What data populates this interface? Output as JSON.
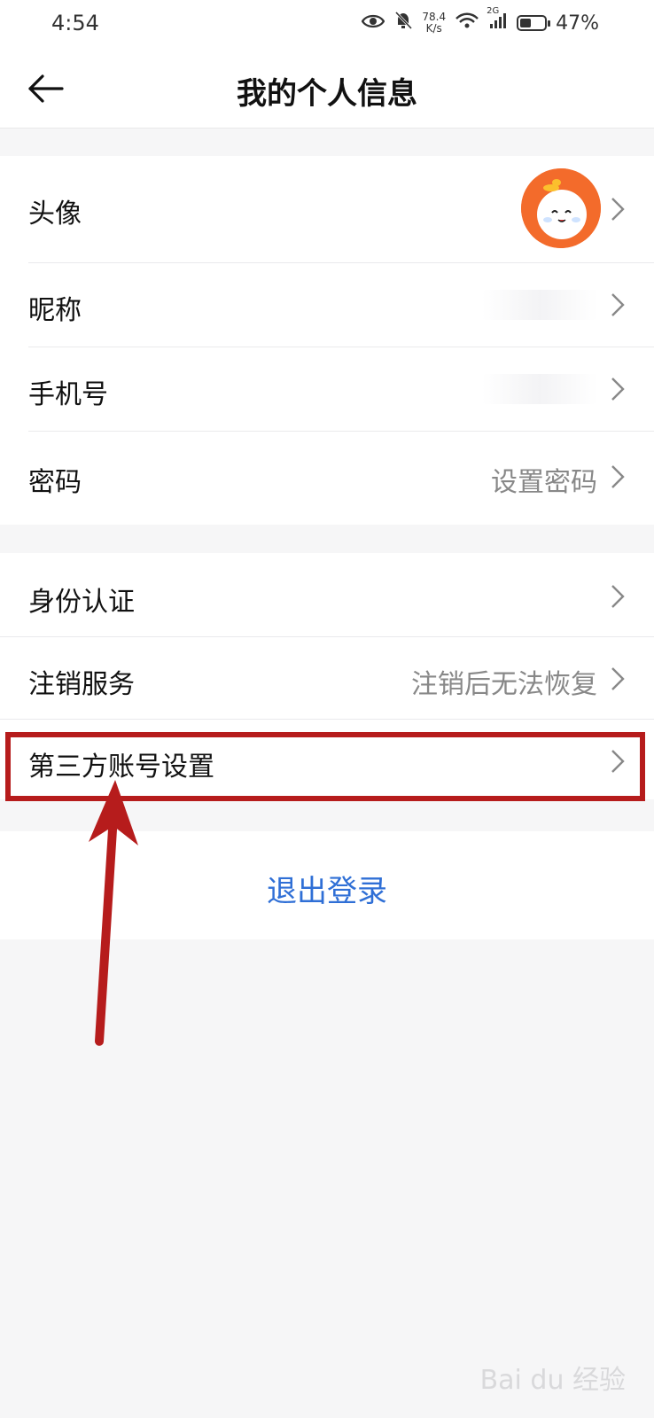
{
  "status_bar": {
    "time": "4:54",
    "net_speed_value": "78.4",
    "net_speed_unit": "K/s",
    "network": "2G",
    "battery": "47%",
    "battery_level": 0.47
  },
  "header": {
    "title": "我的个人信息"
  },
  "group1": {
    "avatar_label": "头像",
    "nickname_label": "昵称",
    "phone_label": "手机号",
    "password_label": "密码",
    "password_value": "设置密码"
  },
  "group2": {
    "id_auth_label": "身份认证",
    "cancel_service_label": "注销服务",
    "cancel_service_value": "注销后无法恢复",
    "third_party_label": "第三方账号设置"
  },
  "logout": {
    "label": "退出登录"
  },
  "watermark": "Bai du 经验",
  "colors": {
    "accent_blue": "#2f6fd6",
    "highlight_red": "#b61c1c",
    "avatar_orange": "#f36b2b"
  }
}
